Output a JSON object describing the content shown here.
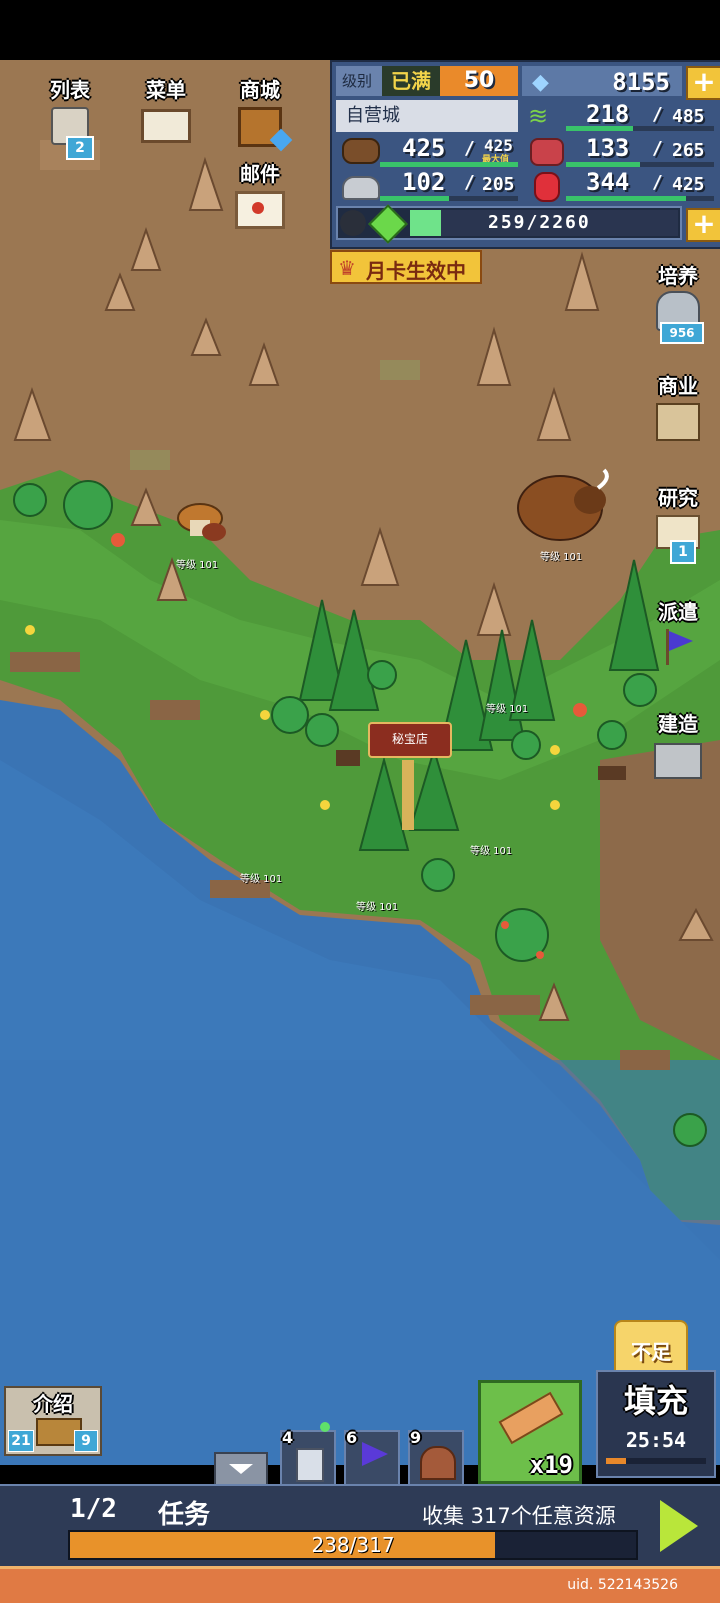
{
  "hud": {
    "level_label": "级别",
    "level_status": "已满",
    "level_value": "50",
    "gems": "8155",
    "city_name": "自营城",
    "wood": {
      "value": "425",
      "max": "425",
      "note": "最大值"
    },
    "stone": {
      "value": "102",
      "max": "205"
    },
    "grass": {
      "value": "218",
      "max": "485"
    },
    "food": {
      "value": "133",
      "max": "265"
    },
    "ore": {
      "value": "344",
      "max": "425"
    },
    "exp": {
      "value": "259",
      "max": "2260"
    },
    "monthly_card": "月卡生效中"
  },
  "left_menu": {
    "list_label": "列表",
    "list_badge": "2",
    "menu_label": "菜单",
    "shop_label": "商城",
    "mail_label": "邮件"
  },
  "right_menu": {
    "train_label": "培养",
    "train_badge": "956",
    "business_label": "商业",
    "research_label": "研究",
    "research_badge": "1",
    "dispatch_label": "派遣",
    "build_label": "建造"
  },
  "map": {
    "shop_sign": "秘宝店",
    "level_tag": "等级 101"
  },
  "bottom": {
    "intro_label": "介绍",
    "intro_left": "21",
    "intro_right": "9",
    "slot1_count": "4",
    "slot2_count": "6",
    "slot3_count": "9",
    "hammer_count": "x19",
    "refill_top": "不足",
    "refill_label": "填充",
    "refill_timer": "25:54",
    "quest_progress": "1/2",
    "quest_title": "任务",
    "quest_desc": "收集 317个任意资源",
    "quest_bar": "238/317",
    "quest_bar_fraction": 0.751,
    "uid": "uid. 522143526"
  },
  "colors": {
    "water": "#3a74b4",
    "grass": "#4f9a3a",
    "dirt": "#9c7652",
    "hud_panel": "#3b5581",
    "accent_gold": "#f0b233"
  }
}
